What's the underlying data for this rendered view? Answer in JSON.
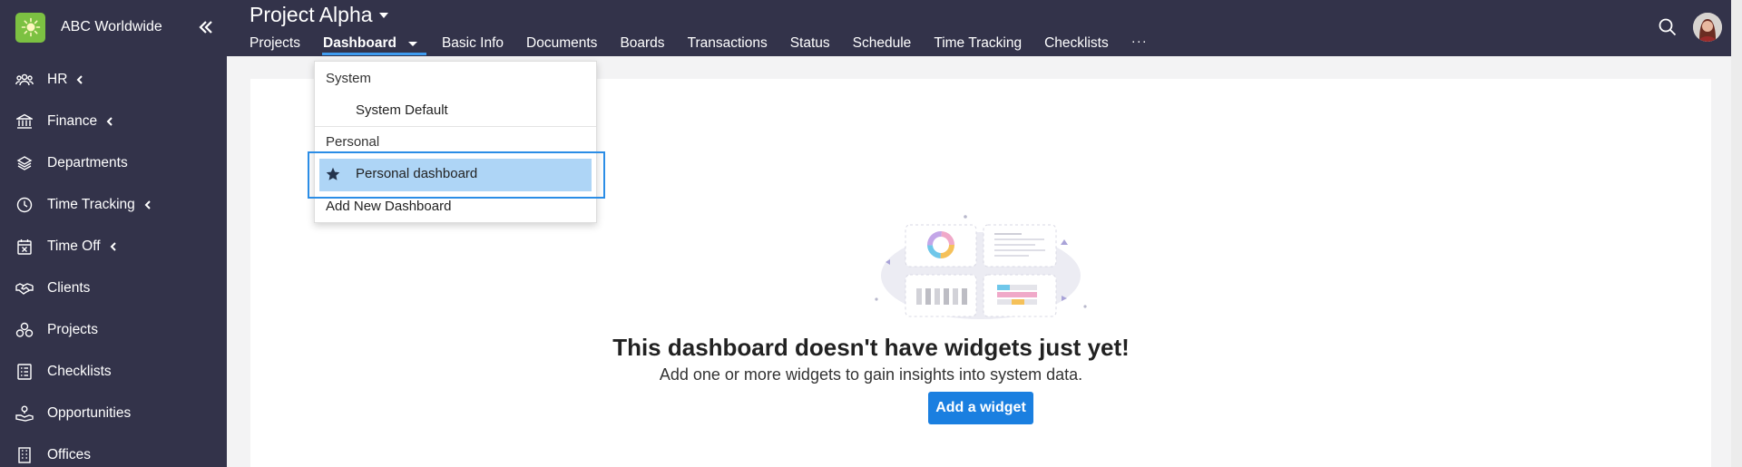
{
  "brand": {
    "name": "ABC Worldwide"
  },
  "sidebar": {
    "items": [
      {
        "label": "HR",
        "icon": "people-icon",
        "has_caret": true
      },
      {
        "label": "Finance",
        "icon": "bank-icon",
        "has_caret": true
      },
      {
        "label": "Departments",
        "icon": "layers-icon",
        "has_caret": false
      },
      {
        "label": "Time Tracking",
        "icon": "clock-icon",
        "has_caret": true
      },
      {
        "label": "Time Off",
        "icon": "calendar-x-icon",
        "has_caret": true
      },
      {
        "label": "Clients",
        "icon": "handshake-icon",
        "has_caret": false
      },
      {
        "label": "Projects",
        "icon": "projects-icon",
        "has_caret": false
      },
      {
        "label": "Checklists",
        "icon": "checklist-icon",
        "has_caret": false
      },
      {
        "label": "Opportunities",
        "icon": "opportunity-icon",
        "has_caret": false
      },
      {
        "label": "Offices",
        "icon": "building-icon",
        "has_caret": false
      }
    ]
  },
  "header": {
    "project_title": "Project Alpha",
    "tabs": [
      {
        "label": "Projects"
      },
      {
        "label": "Dashboard",
        "active": true
      },
      {
        "label": "Basic Info"
      },
      {
        "label": "Documents"
      },
      {
        "label": "Boards"
      },
      {
        "label": "Transactions"
      },
      {
        "label": "Status"
      },
      {
        "label": "Schedule"
      },
      {
        "label": "Time Tracking"
      },
      {
        "label": "Checklists"
      }
    ],
    "more": "···"
  },
  "dropdown": {
    "system_group": "System",
    "system_default": "System Default",
    "personal_group": "Personal",
    "personal_dashboard": "Personal dashboard",
    "add_new": "Add New Dashboard"
  },
  "empty_state": {
    "title": "This dashboard doesn't have widgets just yet!",
    "subtitle": "Add one or more widgets to gain insights into system data.",
    "button": "Add a widget"
  },
  "colors": {
    "sidebar_bg": "#33334a",
    "accent": "#1a7fe0",
    "highlight": "#aed5f6",
    "brand_logo": "#7cc142"
  }
}
